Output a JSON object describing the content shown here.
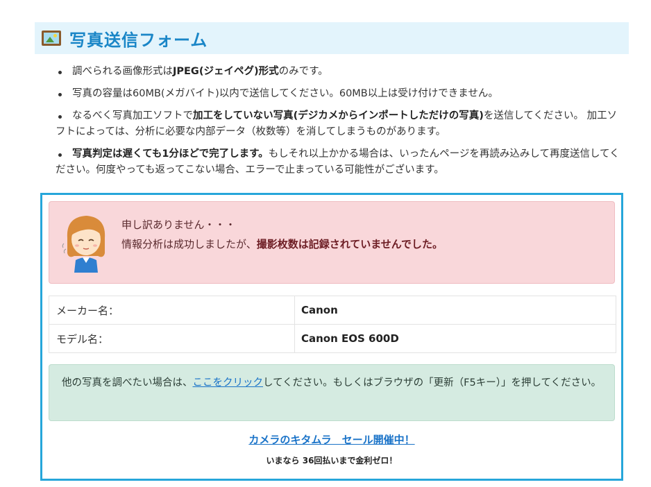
{
  "header": {
    "icon": "picture-frame-icon",
    "title": "写真送信フォーム"
  },
  "rules": [
    {
      "pre": "調べられる画像形式は",
      "bold": "JPEG(ジェイペグ)形式",
      "post": "のみです。"
    },
    {
      "pre": "写真の容量は60MB(メガバイト)以内で送信してください。60MB以上は受け付けできません。",
      "bold": "",
      "post": ""
    },
    {
      "pre": "なるべく写真加工ソフトで",
      "bold": "加工をしていない写真(デジカメからインポートしただけの写真)",
      "post": "を送信してください。 加工ソフトによっては、分析に必要な内部データ（枚数等）を消してしまうものがあります。"
    },
    {
      "pre": "",
      "bold": "写真判定は遅くても1分ほどで完了します。",
      "post": "もしそれ以上かかる場合は、いったんページを再読み込みして再度送信してください。何度やっても返ってこない場合、エラーで止まっている可能性がございます。"
    }
  ],
  "alert": {
    "line1": "申し訳ありません・・・",
    "line2_pre": "情報分析は成功しましたが、",
    "line2_bold": "撮影枚数は記録されていませんでした。"
  },
  "info": {
    "rows": [
      {
        "label": "メーカー名：",
        "value": "Canon"
      },
      {
        "label": "モデル名：",
        "value": "Canon EOS 600D"
      }
    ]
  },
  "retry": {
    "pre": "他の写真を調べたい場合は、",
    "link": "ここをクリック",
    "post": "してください。もしくはブラウザの「更新（F5キー）」を押してください。"
  },
  "promo": {
    "link": "カメラのキタムラ　セール開催中！",
    "sub": "いまなら 36回払いまで金利ゼロ！"
  },
  "colors": {
    "accent": "#1a86c7",
    "box_border": "#26a6da",
    "alert_bg": "#f9d7da",
    "success_bg": "#d5ebe1",
    "link": "#1a73c8"
  }
}
